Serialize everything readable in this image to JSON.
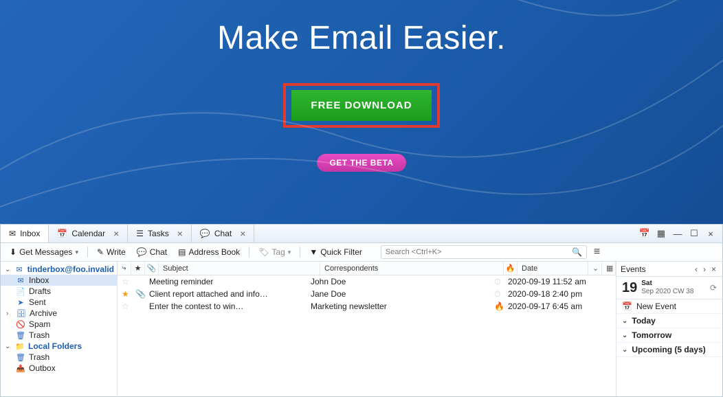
{
  "hero": {
    "headline": "Make Email Easier.",
    "download_label": "FREE DOWNLOAD",
    "beta_label": "GET THE BETA"
  },
  "tabs": [
    {
      "icon": "✉",
      "label": "Inbox",
      "closable": false,
      "active": true
    },
    {
      "icon": "📅",
      "label": "Calendar",
      "closable": true
    },
    {
      "icon": "☰",
      "label": "Tasks",
      "closable": true
    },
    {
      "icon": "💬",
      "label": "Chat",
      "closable": true
    }
  ],
  "toolbar": {
    "get_messages": "Get Messages",
    "write": "Write",
    "chat": "Chat",
    "address_book": "Address Book",
    "tag": "Tag",
    "quick_filter": "Quick Filter",
    "search_placeholder": "Search <Ctrl+K>"
  },
  "folders": {
    "account": "tinderbox@foo.invalid",
    "items": [
      {
        "icon": "✉",
        "label": "Inbox",
        "selected": true
      },
      {
        "icon": "📄",
        "label": "Drafts"
      },
      {
        "icon": "➤",
        "label": "Sent"
      },
      {
        "icon": "🗄",
        "label": "Archive",
        "expandable": true
      },
      {
        "icon": "🚫",
        "label": "Spam"
      },
      {
        "icon": "🗑",
        "label": "Trash"
      }
    ],
    "local_label": "Local Folders",
    "local_items": [
      {
        "icon": "🗑",
        "label": "Trash"
      },
      {
        "icon": "📤",
        "label": "Outbox"
      }
    ]
  },
  "columns": {
    "subject": "Subject",
    "correspondents": "Correspondents",
    "date": "Date"
  },
  "messages": [
    {
      "star": false,
      "att": false,
      "subject": "Meeting reminder",
      "correspondent": "John Doe",
      "fire": false,
      "date": "2020-09-19 11:52 am"
    },
    {
      "star": true,
      "att": true,
      "subject": "Client report attached and info…",
      "correspondent": "Jane Doe",
      "fire": false,
      "date": "2020-09-18 2:40 pm"
    },
    {
      "star": false,
      "att": false,
      "subject": "Enter the contest to win…",
      "correspondent": "Marketing newsletter",
      "fire": true,
      "date": "2020-09-17 6:45 am"
    }
  ],
  "events": {
    "title": "Events",
    "day_num": "19",
    "day_name": "Sat",
    "day_sub": "Sep 2020 CW 38",
    "new_event": "New Event",
    "sections": [
      "Today",
      "Tomorrow",
      "Upcoming (5 days)"
    ]
  }
}
